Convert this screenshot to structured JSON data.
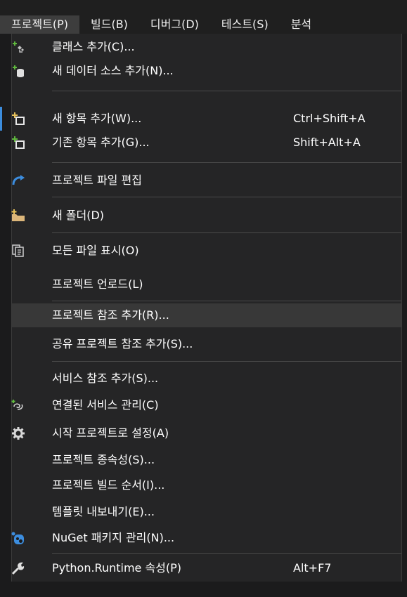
{
  "menubar": {
    "items": [
      "프로젝트(P)",
      "빌드(B)",
      "디버그(D)",
      "테스트(S)",
      "분석"
    ]
  },
  "dropdown": {
    "items": [
      {
        "label": "클래스 추가(C)...",
        "shortcut": "",
        "icon": "add-class-icon"
      },
      {
        "label": "새 데이터 소스 추가(N)...",
        "shortcut": "",
        "icon": "add-data-source-icon"
      },
      {
        "label": "새 항목 추가(W)...",
        "shortcut": "Ctrl+Shift+A",
        "icon": "new-item-icon"
      },
      {
        "label": "기존 항목 추가(G)...",
        "shortcut": "Shift+Alt+A",
        "icon": "existing-item-icon"
      },
      {
        "label": "프로젝트 파일 편집",
        "shortcut": "",
        "icon": "edit-file-icon"
      },
      {
        "label": "새 폴더(D)",
        "shortcut": "",
        "icon": "new-folder-icon"
      },
      {
        "label": "모든 파일 표시(O)",
        "shortcut": "",
        "icon": "show-all-files-icon"
      },
      {
        "label": "프로젝트 언로드(L)",
        "shortcut": "",
        "icon": ""
      },
      {
        "label": "프로젝트 참조 추가(R)...",
        "shortcut": "",
        "icon": ""
      },
      {
        "label": "공유 프로젝트 참조 추가(S)...",
        "shortcut": "",
        "icon": ""
      },
      {
        "label": "서비스 참조 추가(S)...",
        "shortcut": "",
        "icon": ""
      },
      {
        "label": "연결된 서비스 관리(C)",
        "shortcut": "",
        "icon": "connected-services-icon"
      },
      {
        "label": "시작 프로젝트로 설정(A)",
        "shortcut": "",
        "icon": "gear-icon"
      },
      {
        "label": "프로젝트 종속성(S)...",
        "shortcut": "",
        "icon": ""
      },
      {
        "label": "프로젝트 빌드 순서(I)...",
        "shortcut": "",
        "icon": ""
      },
      {
        "label": "템플릿 내보내기(E)...",
        "shortcut": "",
        "icon": ""
      },
      {
        "label": "NuGet 패키지 관리(N)...",
        "shortcut": "",
        "icon": "nuget-icon"
      },
      {
        "label": "Python.Runtime 속성(P)",
        "shortcut": "Alt+F7",
        "icon": "wrench-icon"
      }
    ]
  },
  "colors": {
    "accent_blue": "#3c8dde",
    "plus_green": "#5fb83d",
    "folder_yellow": "#dcb67a",
    "hover_bg": "#383838"
  }
}
